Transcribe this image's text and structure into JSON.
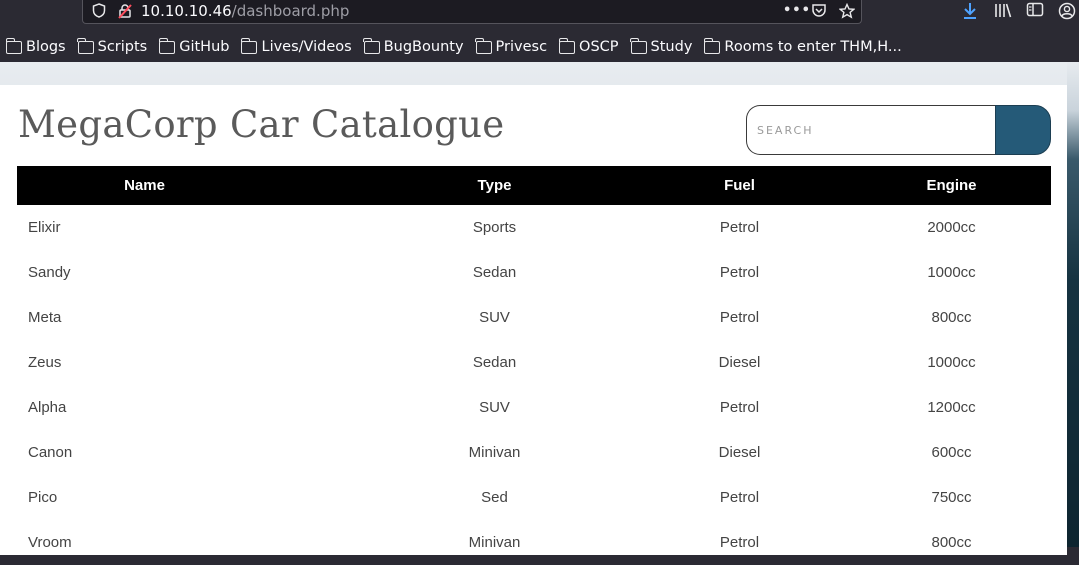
{
  "browser": {
    "url_host": "10.10.10.46",
    "url_path": "/dashboard.php",
    "icons": [
      "shield-icon",
      "insecure-lock-icon",
      "more-actions-icon",
      "pocket-icon",
      "bookmark-star-icon",
      "download-icon",
      "library-icon",
      "sidebar-icon",
      "account-icon"
    ],
    "bookmarks": [
      "Blogs",
      "Scripts",
      "GitHub",
      "Lives/Videos",
      "BugBounty",
      "Privesc",
      "OSCP",
      "Study",
      "Rooms to enter THM,H..."
    ]
  },
  "page": {
    "title": "MegaCorp Car Catalogue",
    "search_placeholder": "SEARCH",
    "accent": "#255a78"
  },
  "table": {
    "headers": [
      "Name",
      "Type",
      "Fuel",
      "Engine"
    ],
    "rows": [
      [
        "Elixir",
        "Sports",
        "Petrol",
        "2000cc"
      ],
      [
        "Sandy",
        "Sedan",
        "Petrol",
        "1000cc"
      ],
      [
        "Meta",
        "SUV",
        "Petrol",
        "800cc"
      ],
      [
        "Zeus",
        "Sedan",
        "Diesel",
        "1000cc"
      ],
      [
        "Alpha",
        "SUV",
        "Petrol",
        "1200cc"
      ],
      [
        "Canon",
        "Minivan",
        "Diesel",
        "600cc"
      ],
      [
        "Pico",
        "Sed",
        "Petrol",
        "750cc"
      ],
      [
        "Vroom",
        "Minivan",
        "Petrol",
        "800cc"
      ]
    ]
  }
}
